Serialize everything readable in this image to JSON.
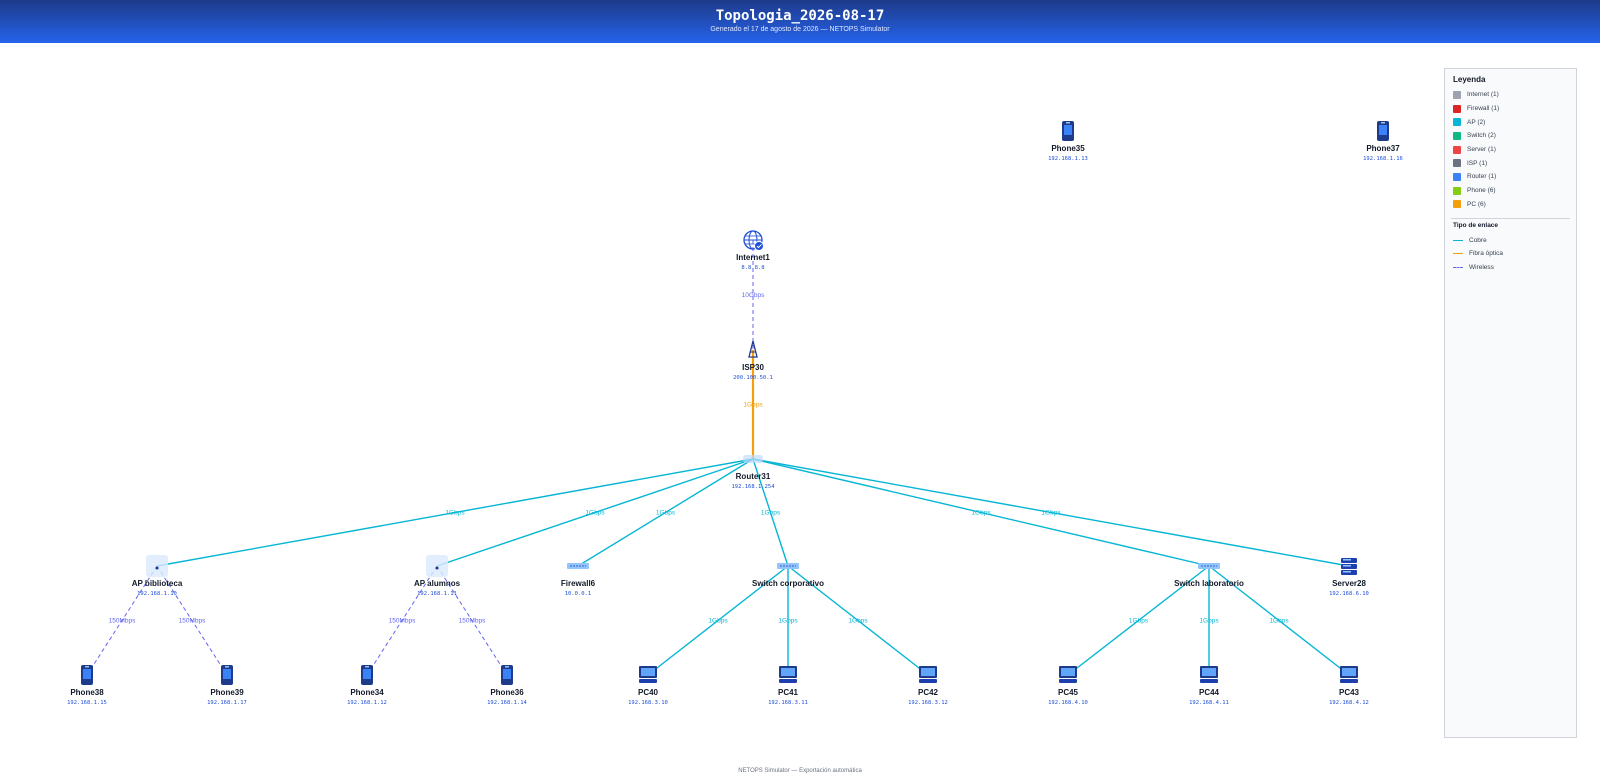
{
  "header": {
    "title": "Topologia_2026-08-17",
    "subtitle": "Generado el 17 de agosto de 2026 — NETOPS Simulator"
  },
  "footer": "NETOPS Simulator — Exportación automática",
  "colors": {
    "copper": "#06b6d4",
    "fiber": "#f59e0b",
    "wireless": "#6366f1"
  },
  "legend": {
    "title": "Leyenda",
    "types": [
      {
        "label": "Internet (1)",
        "color": "#9ca3af"
      },
      {
        "label": "Firewall (1)",
        "color": "#dc2626"
      },
      {
        "label": "AP (2)",
        "color": "#06b6d4"
      },
      {
        "label": "Switch (2)",
        "color": "#10b981"
      },
      {
        "label": "Server (1)",
        "color": "#ef4444"
      },
      {
        "label": "ISP (1)",
        "color": "#6b7280"
      },
      {
        "label": "Router (1)",
        "color": "#3b82f6"
      },
      {
        "label": "Phone (6)",
        "color": "#84cc16"
      },
      {
        "label": "PC (6)",
        "color": "#f59e0b"
      }
    ],
    "link_title": "Tipo de enlace",
    "links": [
      {
        "label": "Cobre",
        "style": "copper"
      },
      {
        "label": "Fibra óptica",
        "style": "fiber"
      },
      {
        "label": "Wireless",
        "style": "wireless"
      }
    ]
  },
  "nodes": [
    {
      "id": "internet1",
      "name": "Internet1",
      "ip": "8.8.8.8",
      "type": "internet",
      "icon": "globe-icon"
    },
    {
      "id": "isp30",
      "name": "ISP30",
      "ip": "200.100.50.1",
      "type": "isp",
      "icon": "antenna-icon"
    },
    {
      "id": "router31",
      "name": "Router31",
      "ip": "192.168.1.254",
      "type": "router",
      "icon": "router-icon"
    },
    {
      "id": "ap_bib",
      "name": "AP biblioteca",
      "ip": "192.168.1.10",
      "type": "ap",
      "icon": "access-point-icon"
    },
    {
      "id": "ap_alu",
      "name": "AP alumnos",
      "ip": "192.168.1.11",
      "type": "ap",
      "icon": "access-point-icon"
    },
    {
      "id": "fw6",
      "name": "Firewall6",
      "ip": "10.0.0.1",
      "type": "firewall",
      "icon": "firewall-icon"
    },
    {
      "id": "sw_corp",
      "name": "Switch corporativo",
      "ip": "",
      "type": "switch",
      "icon": "switch-icon"
    },
    {
      "id": "sw_lab",
      "name": "Switch laboratorio",
      "ip": "",
      "type": "switch",
      "icon": "switch-icon"
    },
    {
      "id": "server28",
      "name": "Server28",
      "ip": "192.168.6.10",
      "type": "server",
      "icon": "server-icon"
    },
    {
      "id": "phone35",
      "name": "Phone35",
      "ip": "192.168.1.13",
      "type": "phone",
      "icon": "phone-icon"
    },
    {
      "id": "phone37",
      "name": "Phone37",
      "ip": "192.168.1.16",
      "type": "phone",
      "icon": "phone-icon"
    },
    {
      "id": "phone38",
      "name": "Phone38",
      "ip": "192.168.1.15",
      "type": "phone",
      "icon": "phone-icon"
    },
    {
      "id": "phone39",
      "name": "Phone39",
      "ip": "192.168.1.17",
      "type": "phone",
      "icon": "phone-icon"
    },
    {
      "id": "phone34",
      "name": "Phone34",
      "ip": "192.168.1.12",
      "type": "phone",
      "icon": "phone-icon"
    },
    {
      "id": "phone36",
      "name": "Phone36",
      "ip": "192.168.1.14",
      "type": "phone",
      "icon": "phone-icon"
    },
    {
      "id": "pc40",
      "name": "PC40",
      "ip": "192.168.3.10",
      "type": "pc",
      "icon": "pc-icon"
    },
    {
      "id": "pc41",
      "name": "PC41",
      "ip": "192.168.3.11",
      "type": "pc",
      "icon": "pc-icon"
    },
    {
      "id": "pc42",
      "name": "PC42",
      "ip": "192.168.3.12",
      "type": "pc",
      "icon": "pc-icon"
    },
    {
      "id": "pc45",
      "name": "PC45",
      "ip": "192.168.4.10",
      "type": "pc",
      "icon": "pc-icon"
    },
    {
      "id": "pc44",
      "name": "PC44",
      "ip": "192.168.4.11",
      "type": "pc",
      "icon": "pc-icon"
    },
    {
      "id": "pc43",
      "name": "PC43",
      "ip": "192.168.4.12",
      "type": "pc",
      "icon": "pc-icon"
    }
  ],
  "links": [
    {
      "from": "internet1",
      "to": "isp30",
      "kind": "wireless",
      "speed": "10Gbps"
    },
    {
      "from": "isp30",
      "to": "router31",
      "kind": "fiber",
      "speed": "1Gbps"
    },
    {
      "from": "router31",
      "to": "ap_bib",
      "kind": "copper",
      "speed": "1Gbps"
    },
    {
      "from": "router31",
      "to": "ap_alu",
      "kind": "copper",
      "speed": "1Gbps"
    },
    {
      "from": "router31",
      "to": "fw6",
      "kind": "copper",
      "speed": "1Gbps"
    },
    {
      "from": "router31",
      "to": "sw_corp",
      "kind": "copper",
      "speed": "1Gbps"
    },
    {
      "from": "router31",
      "to": "sw_lab",
      "kind": "copper",
      "speed": "1Gbps"
    },
    {
      "from": "router31",
      "to": "server28",
      "kind": "copper",
      "speed": "1Gbps"
    },
    {
      "from": "ap_bib",
      "to": "phone38",
      "kind": "wireless",
      "speed": "150Mbps"
    },
    {
      "from": "ap_bib",
      "to": "phone39",
      "kind": "wireless",
      "speed": "150Mbps"
    },
    {
      "from": "ap_alu",
      "to": "phone34",
      "kind": "wireless",
      "speed": "150Mbps"
    },
    {
      "from": "ap_alu",
      "to": "phone36",
      "kind": "wireless",
      "speed": "150Mbps"
    },
    {
      "from": "sw_corp",
      "to": "pc40",
      "kind": "copper",
      "speed": "1Gbps"
    },
    {
      "from": "sw_corp",
      "to": "pc41",
      "kind": "copper",
      "speed": "1Gbps"
    },
    {
      "from": "sw_corp",
      "to": "pc42",
      "kind": "copper",
      "speed": "1Gbps"
    },
    {
      "from": "sw_lab",
      "to": "pc45",
      "kind": "copper",
      "speed": "1Gbps"
    },
    {
      "from": "sw_lab",
      "to": "pc44",
      "kind": "copper",
      "speed": "1Gbps"
    },
    {
      "from": "sw_lab",
      "to": "pc43",
      "kind": "copper",
      "speed": "1Gbps"
    }
  ]
}
